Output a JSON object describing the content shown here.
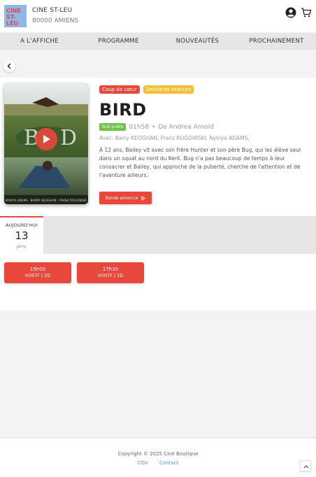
{
  "header": {
    "logo_alt": "CINÉ ST-LEU",
    "cinema_name": "CINE ST-LEU",
    "city": "80000 AMIENS",
    "user_icon": "user-circle-icon",
    "cart_icon": "cart-icon"
  },
  "nav": {
    "items": [
      {
        "label": "A L'AFFICHE"
      },
      {
        "label": "PROGRAMME"
      },
      {
        "label": "NOUVEAUTÉS"
      },
      {
        "label": "PROCHAINEMENT"
      }
    ]
  },
  "back_icon": "chevron-left-icon",
  "movie": {
    "poster_credits": [
      "NYKIYA ADAMS",
      "BARRY KEOGHAN",
      "FRANZ ROGOWSKI"
    ],
    "tags": [
      "Coup de cœur",
      "Dernières séances"
    ],
    "title": "BIRD",
    "rating": "Tout public",
    "duration": "01h58",
    "separator": "•",
    "director": "De Andrea Arnold",
    "cast": "Avec: Barry KEOGHAN, Franz ROGOWSKI, Nykiya ADAMS,",
    "synopsis": "À 12 ans, Bailey vit avec son frère Hunter et son père Bug, qui les élève seul dans un squat au nord du Kent. Bug n'a pas beaucoup de temps à leur consacrer et Bailey, qui approche de la puberté, cherche de l'attention et de l'aventure ailleurs.",
    "trailer_label": "Bande annonce"
  },
  "date": {
    "label": "AUJOURD'HUI",
    "day": "13",
    "month": "janv."
  },
  "showtimes": [
    {
      "time": "15h00",
      "version": "VOSTF | 2D"
    },
    {
      "time": "17h30",
      "version": "VOSTF | 2D"
    }
  ],
  "footer": {
    "copyright": "Copyright © 2025 Ciné Boutique",
    "links": [
      "CGV",
      "Contact"
    ]
  },
  "colors": {
    "accent": "#e8473b",
    "tag_yellow": "#f3bf35",
    "rating_green": "#6fbf4b",
    "link_blue": "#5b8fd6"
  }
}
